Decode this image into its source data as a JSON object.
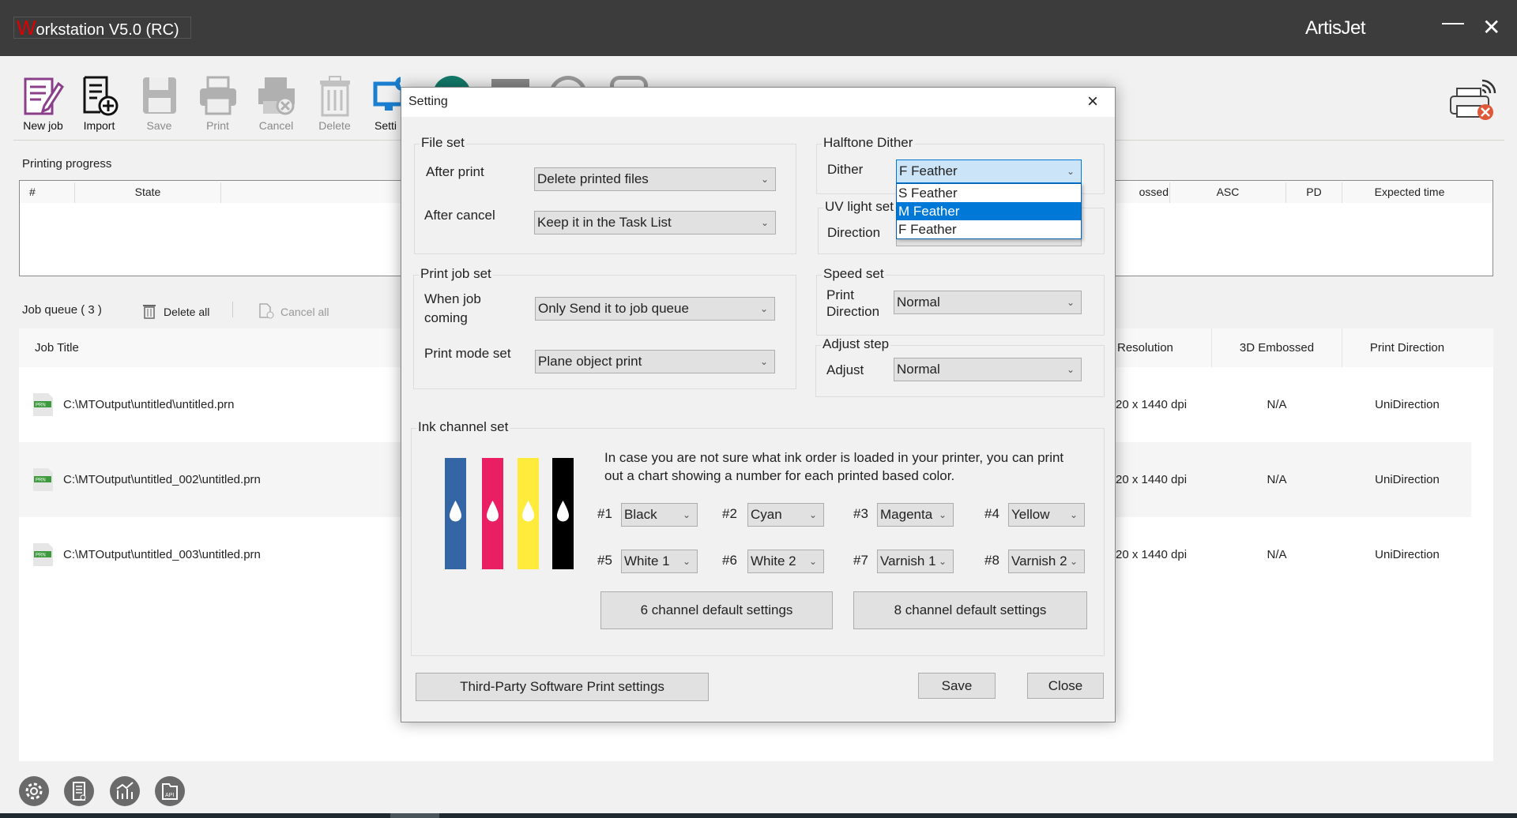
{
  "app": {
    "title_initial": "W",
    "title_rest": "orkstation V5.0 (RC)",
    "brand": "ArtisJet",
    "accent": "#e00000"
  },
  "toolbar": {
    "items": [
      {
        "label": "New job",
        "icon": "new-job-icon"
      },
      {
        "label": "Import",
        "icon": "import-icon"
      },
      {
        "label": "Save",
        "icon": "save-icon"
      },
      {
        "label": "Print",
        "icon": "print-icon"
      },
      {
        "label": "Cancel",
        "icon": "cancel-print-icon"
      },
      {
        "label": "Delete",
        "icon": "trash-icon"
      },
      {
        "label": "Setti",
        "icon": "monitor-gear-icon"
      }
    ],
    "printer_status": "printer-offline-icon"
  },
  "progress": {
    "label": "Printing progress",
    "columns": [
      "#",
      "State",
      "ossed",
      "ASC",
      "PD",
      "Expected time"
    ]
  },
  "queue": {
    "label": "Job queue ( 3 )",
    "delete_all": "Delete all",
    "cancel_all": "Cancel all",
    "columns": [
      "Job Title",
      "Resolution",
      "3D Embossed",
      "Print Direction"
    ],
    "rows": [
      {
        "title": "C:\\MTOutput\\untitled\\untitled.prn",
        "resolution": "20 x 1440 dpi",
        "embossed": "N/A",
        "direction": "UniDirection"
      },
      {
        "title": "C:\\MTOutput\\untitled_002\\untitled.prn",
        "resolution": "20 x 1440 dpi",
        "embossed": "N/A",
        "direction": "UniDirection"
      },
      {
        "title": "C:\\MTOutput\\untitled_003\\untitled.prn",
        "resolution": "20 x 1440 dpi",
        "embossed": "N/A",
        "direction": "UniDirection"
      }
    ],
    "file_badge": "PRN"
  },
  "bottom_icons": [
    "settings-gear-icon",
    "report-icon",
    "statistics-chart-icon",
    "api-folder-icon"
  ],
  "dialog": {
    "title": "Setting",
    "file_set": {
      "title": "File set",
      "after_print_label": "After print",
      "after_print_value": "Delete printed files",
      "after_cancel_label": "After cancel",
      "after_cancel_value": "Keep it in the Task List"
    },
    "print_job_set": {
      "title": "Print job set",
      "when_job_label_1": "When job",
      "when_job_label_2": "coming",
      "when_job_value": "Only Send it to job queue",
      "print_mode_label": "Print mode set",
      "print_mode_value": "Plane object print"
    },
    "halftone": {
      "title": "Halftone Dither",
      "dither_label": "Dither",
      "dither_value": "F Feather",
      "options": [
        "S Feather",
        "M Feather",
        "F Feather"
      ],
      "highlighted": "M Feather"
    },
    "uv": {
      "title": "UV light set",
      "direction_label": "Direction"
    },
    "speed": {
      "title": "Speed set",
      "label_1": "Print",
      "label_2": "Direction",
      "value": "Normal"
    },
    "adjust": {
      "title": "Adjust step",
      "label": "Adjust",
      "value": "Normal"
    },
    "ink": {
      "title": "Ink channel set",
      "info": "In case you are not sure what ink order is loaded in your printer, you can print out a chart showing a number for each printed based color.",
      "bar_colors": [
        "#3465a4",
        "#e91e63",
        "#ffeb3b",
        "#000000"
      ],
      "channels": [
        {
          "num": "#1",
          "value": "Black"
        },
        {
          "num": "#2",
          "value": "Cyan"
        },
        {
          "num": "#3",
          "value": "Magenta"
        },
        {
          "num": "#4",
          "value": "Yellow"
        },
        {
          "num": "#5",
          "value": "White 1"
        },
        {
          "num": "#6",
          "value": "White 2"
        },
        {
          "num": "#7",
          "value": "Varnish 1"
        },
        {
          "num": "#8",
          "value": "Varnish 2"
        }
      ],
      "six_channel_btn": "6 channel default settings",
      "eight_channel_btn": "8 channel default settings"
    },
    "third_party_btn": "Third-Party Software Print settings",
    "save_btn": "Save",
    "close_btn": "Close"
  }
}
